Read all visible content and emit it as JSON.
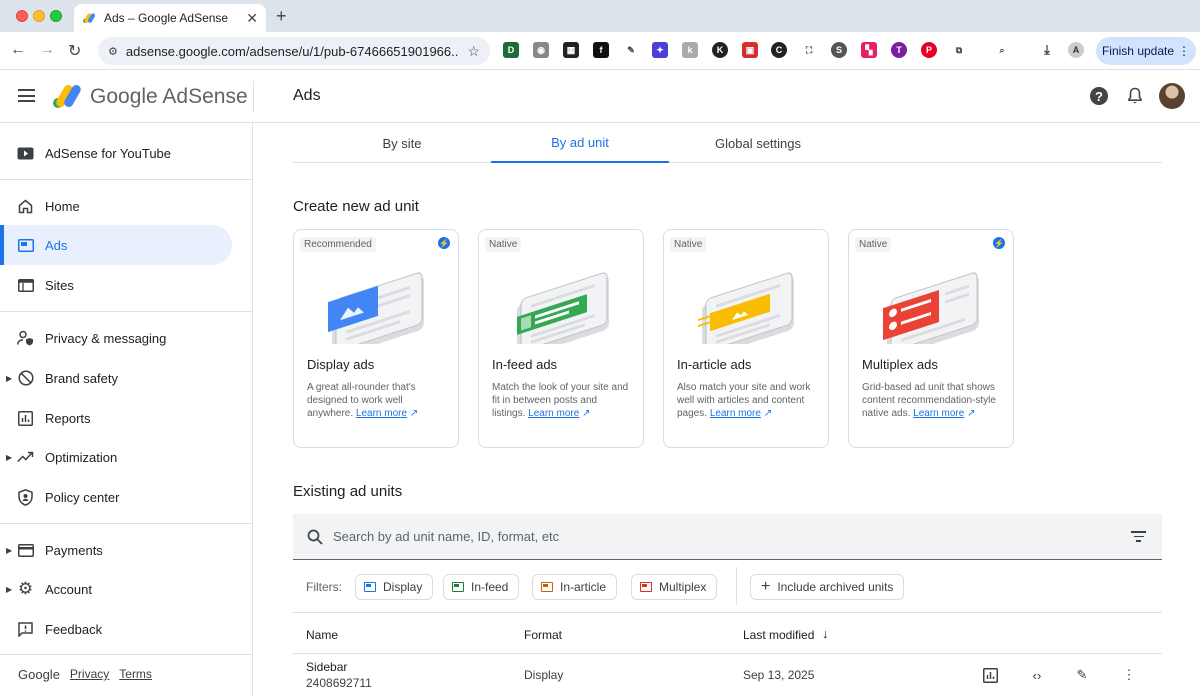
{
  "browser": {
    "tab_title": "Ads – Google AdSense",
    "url": "adsense.google.com/adsense/u/1/pub-67466651901966...",
    "finish_update": "Finish update"
  },
  "header": {
    "brand": "Google AdSense",
    "page_title": "Ads"
  },
  "sidebar": {
    "top_item": "AdSense for YouTube",
    "items": [
      {
        "label": "Home",
        "icon": "home-icon"
      },
      {
        "label": "Ads",
        "icon": "ads-icon",
        "active": true
      },
      {
        "label": "Sites",
        "icon": "sites-icon"
      },
      {
        "label": "Privacy & messaging",
        "icon": "privacy-icon"
      },
      {
        "label": "Brand safety",
        "icon": "brand-safety-icon",
        "expandable": true
      },
      {
        "label": "Reports",
        "icon": "reports-icon"
      },
      {
        "label": "Optimization",
        "icon": "optimization-icon",
        "expandable": true
      },
      {
        "label": "Policy center",
        "icon": "policy-icon"
      },
      {
        "label": "Payments",
        "icon": "payments-icon",
        "expandable": true
      },
      {
        "label": "Account",
        "icon": "gear-icon",
        "expandable": true
      },
      {
        "label": "Feedback",
        "icon": "feedback-icon"
      }
    ],
    "footer": {
      "google": "Google",
      "privacy": "Privacy",
      "terms": "Terms"
    }
  },
  "tabs": [
    "By site",
    "By ad unit",
    "Global settings"
  ],
  "create_title": "Create new ad unit",
  "cards": [
    {
      "badge": "Recommended",
      "title": "Display ads",
      "desc": "A great all-rounder that's designed to work well anywhere.",
      "learn": "Learn more",
      "color": "#4285f4"
    },
    {
      "badge": "Native",
      "title": "In-feed ads",
      "desc": "Match the look of your site and fit in between posts and listings.",
      "learn": "Learn more",
      "color": "#34a853"
    },
    {
      "badge": "Native",
      "title": "In-article ads",
      "desc": "Also match your site and work well with articles and content pages.",
      "learn": "Learn more",
      "color": "#fbbc04"
    },
    {
      "badge": "Native",
      "title": "Multiplex ads",
      "desc": "Grid-based ad unit that shows content recommendation-style native ads.",
      "learn": "Learn more",
      "color": "#ea4335"
    }
  ],
  "existing_title": "Existing ad units",
  "search_placeholder": "Search by ad unit name, ID, format, etc",
  "filters": {
    "label": "Filters:",
    "chips": [
      "Display",
      "In-feed",
      "In-article",
      "Multiplex"
    ],
    "archived": "Include archived units"
  },
  "table": {
    "headers": [
      "Name",
      "Format",
      "Last modified"
    ],
    "rows": [
      {
        "name": "Sidebar",
        "id": "2408692711",
        "format": "Display",
        "modified": "Sep 13, 2025"
      }
    ]
  }
}
